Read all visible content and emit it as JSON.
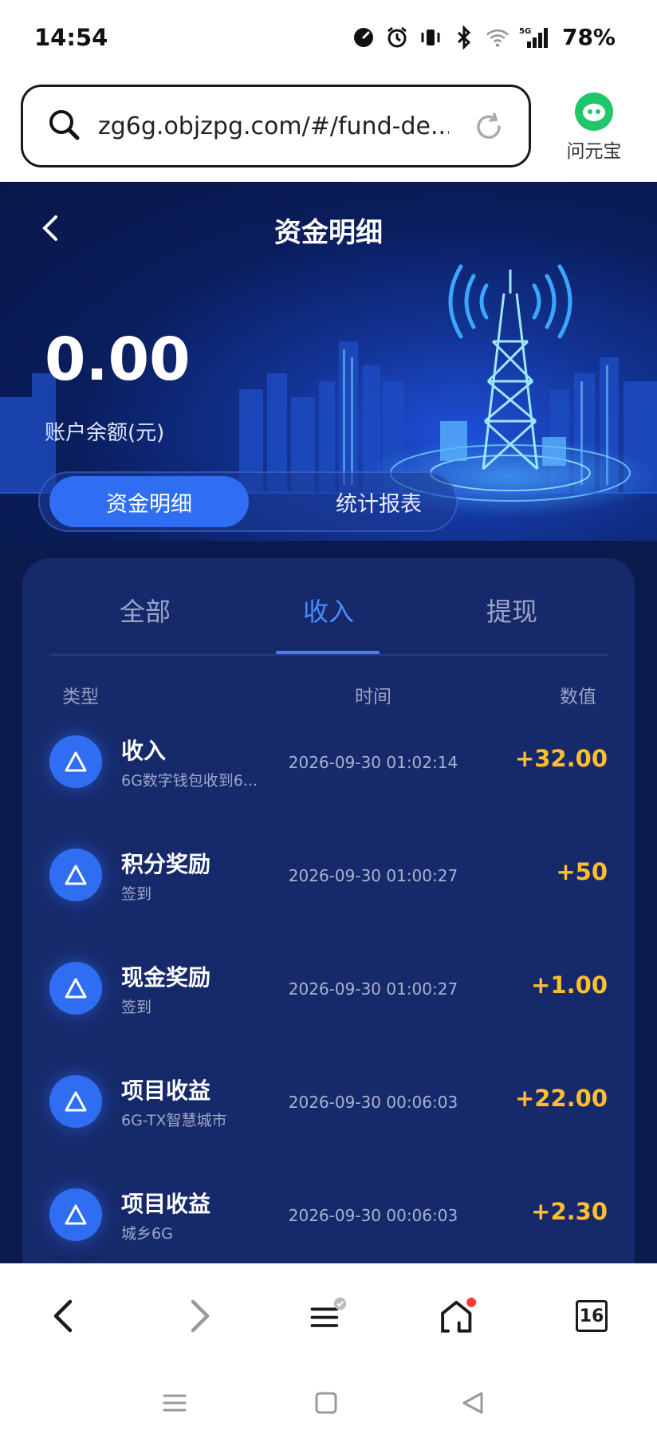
{
  "status_bar": {
    "time": "14:54",
    "network": "5G",
    "battery": "78%",
    "icons": [
      "speedometer-icon",
      "alarm-icon",
      "vibrate-icon",
      "bluetooth-icon",
      "wifi-icon",
      "signal-icon"
    ]
  },
  "browser": {
    "url": "zg6g.objzpg.com/#/fund-de...",
    "assistant_label": "问元宝",
    "tab_count": "16"
  },
  "header": {
    "title": "资金明细"
  },
  "account": {
    "balance": "0.00",
    "balance_label": "账户余额(元)"
  },
  "segment": {
    "active": "资金明细",
    "inactive": "统计报表"
  },
  "tabs": {
    "all": "全部",
    "income": "收入",
    "withdraw": "提现",
    "selected": "收入"
  },
  "columns": {
    "type": "类型",
    "time": "时间",
    "value": "数值"
  },
  "records": [
    {
      "title": "收入",
      "sub": "6G数字钱包收到6...",
      "time": "2026-09-30 01:02:14",
      "amount": "+32.00"
    },
    {
      "title": "积分奖励",
      "sub": "签到",
      "time": "2026-09-30 01:00:27",
      "amount": "+50"
    },
    {
      "title": "现金奖励",
      "sub": "签到",
      "time": "2026-09-30 01:00:27",
      "amount": "+1.00"
    },
    {
      "title": "项目收益",
      "sub": "6G-TX智慧城市",
      "time": "2026-09-30 00:06:03",
      "amount": "+22.00"
    },
    {
      "title": "项目收益",
      "sub": "城乡6G",
      "time": "2026-09-30 00:06:03",
      "amount": "+2.30"
    }
  ],
  "colors": {
    "accent": "#2f6ef2",
    "amount": "#ffbe2e",
    "background": "#0b1b4d",
    "card": "#16296a"
  }
}
